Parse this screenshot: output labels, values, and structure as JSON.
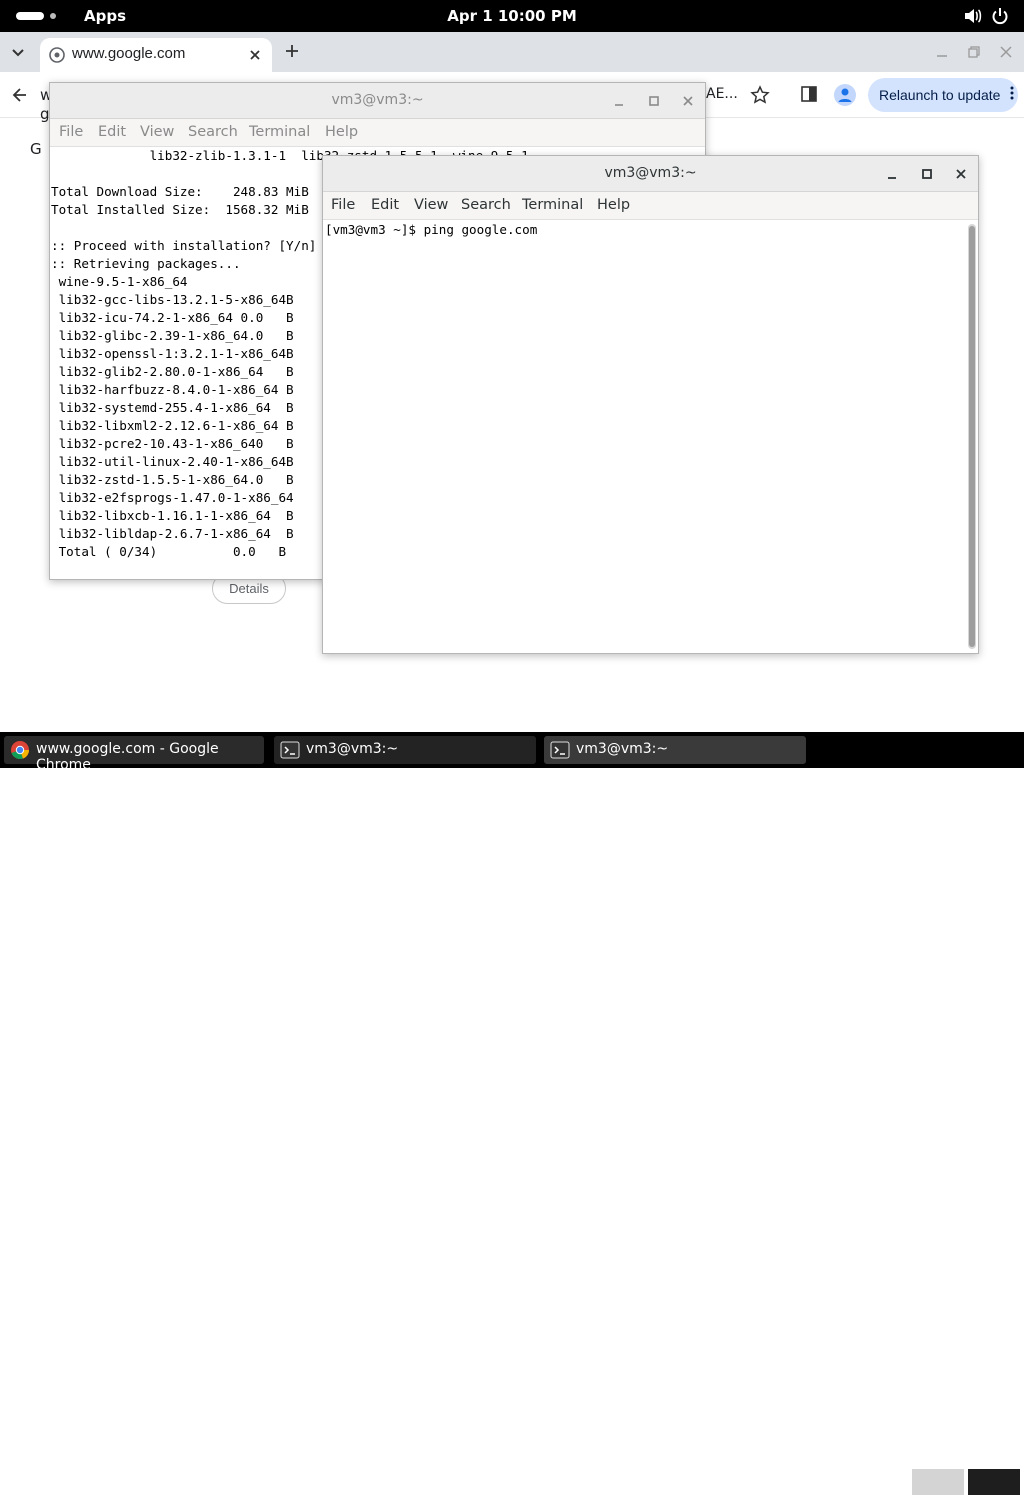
{
  "topbar": {
    "apps_label": "Apps",
    "clock": "Apr 1  10:00 PM"
  },
  "chrome": {
    "tab_title": "www.google.com",
    "omnibox_left_fragment": "w",
    "omnibox_left_fragment2": "g",
    "omnibox_right_fragment": "AE...",
    "relaunch_label": "Relaunch to update",
    "left_strip_fragment": "G",
    "details_label": "Details"
  },
  "terminal_back": {
    "title": "vm3@vm3:~",
    "menu": [
      "File",
      "Edit",
      "View",
      "Search",
      "Terminal",
      "Help"
    ],
    "lines": [
      "             lib32-zlib-1.3.1-1  lib32-zstd-1.5.5-1  wine-9.5-1",
      "",
      "Total Download Size:    248.83 MiB",
      "Total Installed Size:  1568.32 MiB",
      "",
      ":: Proceed with installation? [Y/n]",
      ":: Retrieving packages...",
      " wine-9.5-1-x86_64",
      " lib32-gcc-libs-13.2.1-5-x86_64B",
      " lib32-icu-74.2-1-x86_64 0.0   B",
      " lib32-glibc-2.39-1-x86_64.0   B",
      " lib32-openssl-1:3.2.1-1-x86_64B",
      " lib32-glib2-2.80.0-1-x86_64   B",
      " lib32-harfbuzz-8.4.0-1-x86_64 B",
      " lib32-systemd-255.4-1-x86_64  B",
      " lib32-libxml2-2.12.6-1-x86_64 B",
      " lib32-pcre2-10.43-1-x86_640   B",
      " lib32-util-linux-2.40-1-x86_64B",
      " lib32-zstd-1.5.5-1-x86_64.0   B",
      " lib32-e2fsprogs-1.47.0-1-x86_64",
      " lib32-libxcb-1.16.1-1-x86_64  B",
      " lib32-libldap-2.6.7-1-x86_64  B",
      " Total ( 0/34)          0.0   B"
    ]
  },
  "terminal_front": {
    "title": "vm3@vm3:~",
    "menu": [
      "File",
      "Edit",
      "View",
      "Search",
      "Terminal",
      "Help"
    ],
    "prompt_line": "[vm3@vm3 ~]$ ping google.com"
  },
  "taskbar": {
    "items": [
      {
        "label": "www.google.com - Google Chrome"
      },
      {
        "label": "vm3@vm3:~"
      },
      {
        "label": "vm3@vm3:~"
      }
    ]
  },
  "colors": {
    "chrome_tabstrip": "#dee1e6",
    "relaunch_bg": "#d3e3fd",
    "topbar": "#000000",
    "terminal_header": "#ececec"
  },
  "icons": [
    "volume-icon",
    "power-icon",
    "globe-icon",
    "close-icon",
    "plus-icon",
    "back-arrow-icon",
    "star-icon",
    "side-panel-icon",
    "profile-icon",
    "kebab-menu-icon",
    "chrome-icon",
    "terminal-icon"
  ]
}
